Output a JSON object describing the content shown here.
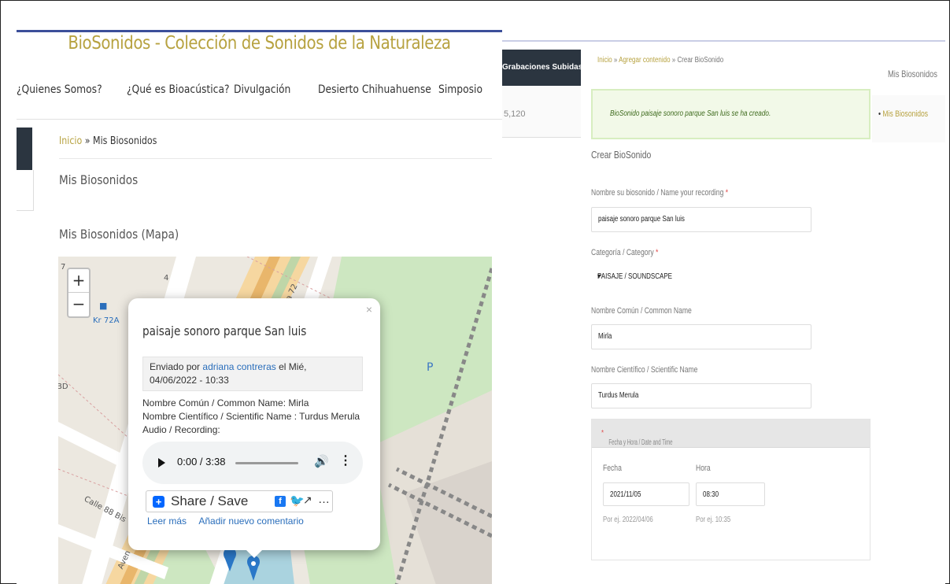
{
  "left": {
    "site_title": "BioSonidos - Colección de Sonidos de la Naturaleza",
    "nav": [
      "¿Quienes Somos?",
      "¿Qué es Bioacústica?",
      "Divulgación",
      "Desierto Chihuahuense",
      "Simposio"
    ],
    "breadcrumb": {
      "home": "Inicio",
      "sep": " » ",
      "current": "Mis Biosonidos"
    },
    "heading": "Mis Biosonidos",
    "map_heading": "Mis Biosonidos (Mapa)",
    "map": {
      "zoom_in": "+",
      "zoom_out": "−",
      "labels": {
        "kr72a": "Kr 72A",
        "c72": "a 72",
        "calle88": "Calle 88 Bis",
        "bd": "BD",
        "avenue": "Aven",
        "p": "P",
        "seven": "7",
        "four": "4"
      }
    },
    "popup": {
      "close": "×",
      "title": "paisaje sonoro parque San luis",
      "sent_prefix": "Enviado por",
      "author": "adriana contreras",
      "sent_suffix": "el Mié, 04/06/2022 - 10:33",
      "common_name": "Nombre Común / Common Name: Mirla",
      "scientific_name": "Nombre Científico / Scientific Name : Turdus Merula",
      "audio_label": "Audio / Recording:",
      "audio_time": "0:00 / 3:38",
      "share_label": "Share / Save",
      "read_more": "Leer más",
      "add_comment": "Añadir nuevo comentario"
    }
  },
  "right": {
    "recordings_tab": "Grabaciones Subidas",
    "recordings_count": "5,120",
    "breadcrumb": {
      "home": "Inicio",
      "sep1": " » ",
      "add": "Agregar contenido",
      "sep2": " » ",
      "current": "Crear BioSonido"
    },
    "sidebar_title": "Mis Biosonidos",
    "sidebar_link": "Mis Biosonidos",
    "sidebar_bullet": "•",
    "success_message": "BioSonido paisaje sonoro parque San luis se ha creado.",
    "form_title": "Crear BioSonido",
    "fields": {
      "name_label": "Nombre su biosonido / Name your recording",
      "name_value": "paisaje sonoro parque San luis",
      "category_label": "Categoría / Category",
      "category_value": "PAISAJE / SOUNDSCAPE",
      "common_label": "Nombre Común / Common Name",
      "common_value": "Mirla",
      "scientific_label": "Nombre Científico / Scientific Name",
      "scientific_value": "Turdus Merula",
      "required_mark": "*"
    },
    "datetime": {
      "header": "Fecha y Hora / Date and Time",
      "date_label": "Fecha",
      "date_value": "2021/11/05",
      "date_hint": "Por ej. 2022/04/06",
      "time_label": "Hora",
      "time_value": "08:30",
      "time_hint": "Por ej. 10:35"
    }
  },
  "colors": {
    "accent_gold": "#b7a240",
    "dark_nav": "#2b3540",
    "link_blue": "#2a6ebb"
  },
  "icons": [
    "plus-icon",
    "minus-icon",
    "close-icon",
    "play-icon",
    "volume-icon",
    "more-icon",
    "share-icon",
    "facebook-icon",
    "twitter-icon",
    "map-marker-icon",
    "bus-stop-icon",
    "chevron-down-icon"
  ]
}
